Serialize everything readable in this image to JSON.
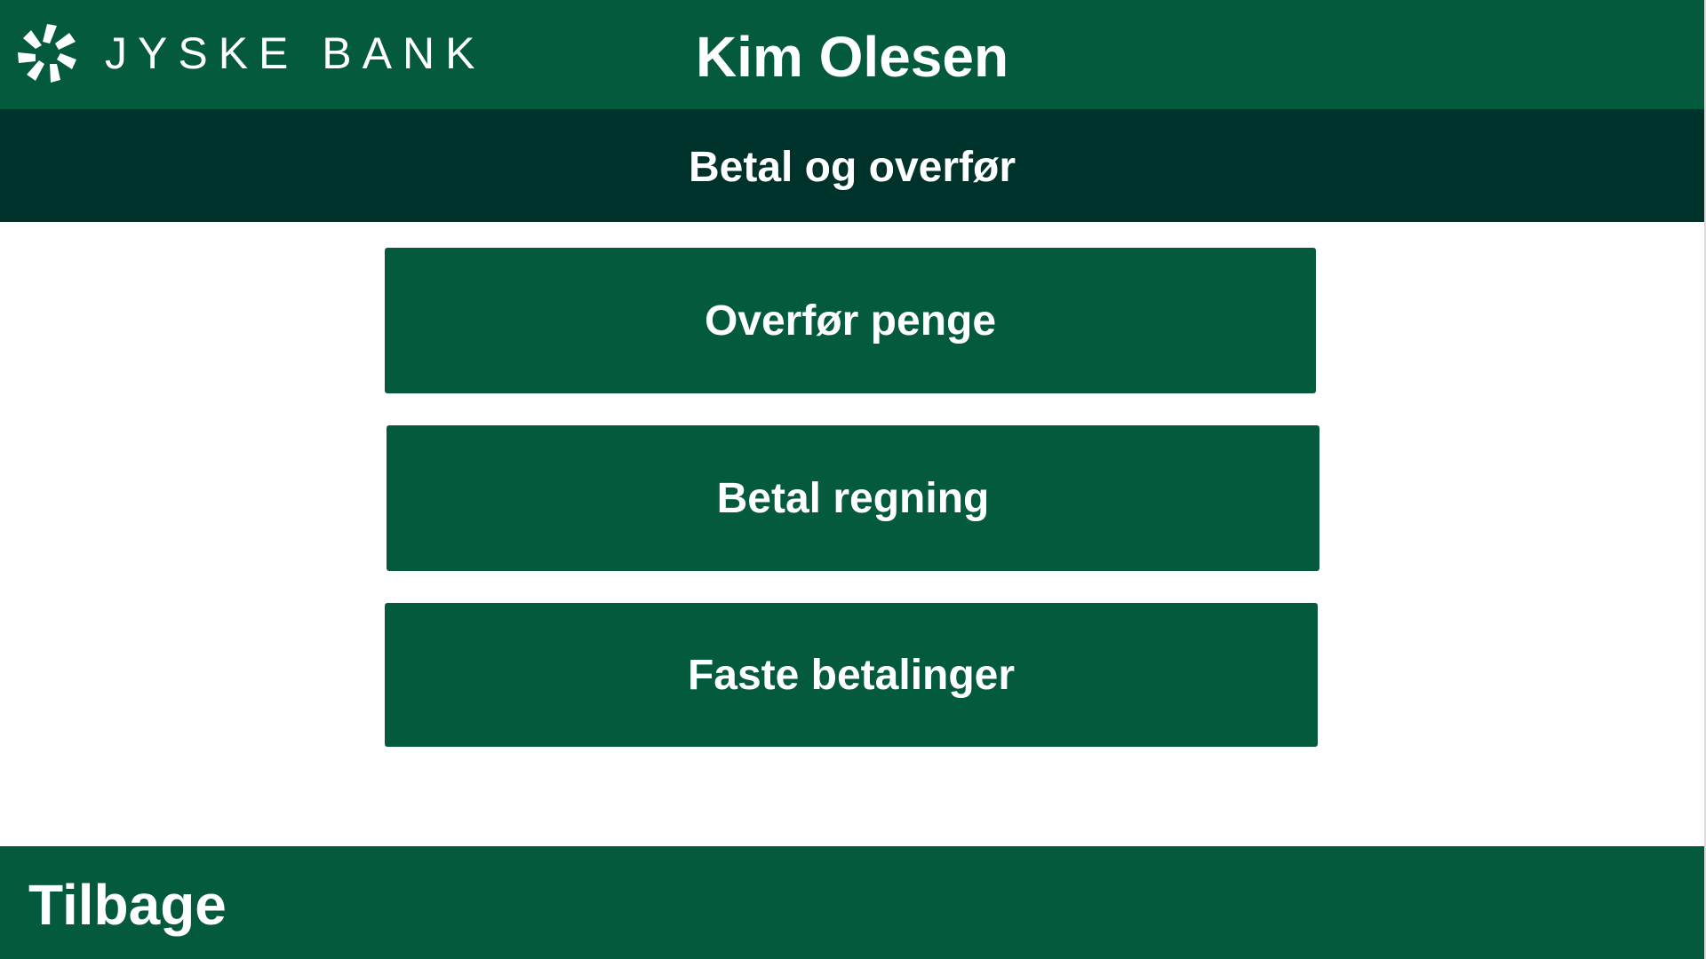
{
  "header": {
    "brand_name": "JYSKE BANK",
    "brand_logo_icon": "jyske-bank-logo-icon",
    "user_name": "Kim Olesen"
  },
  "section": {
    "title": "Betal og overfør"
  },
  "menu": {
    "items": [
      {
        "label": "Overfør penge"
      },
      {
        "label": "Betal regning"
      },
      {
        "label": "Faste betalinger"
      }
    ]
  },
  "footer": {
    "back_label": "Tilbage"
  },
  "colors": {
    "primary_green": "#035a3c",
    "dark_green": "#00322c",
    "background": "#ffffff",
    "text": "#ffffff"
  }
}
